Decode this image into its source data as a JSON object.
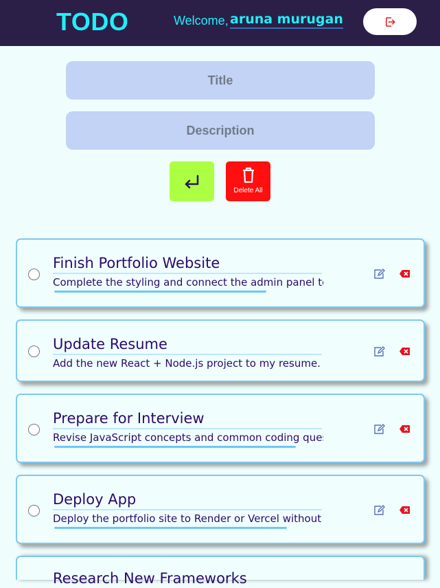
{
  "header": {
    "logo": "TODO",
    "welcome_text": "Welcome,",
    "user_name": "aruna murugan",
    "logout_icon": "logout-icon"
  },
  "form": {
    "title_placeholder": "Title",
    "description_placeholder": "Description",
    "enter_icon": "enter-icon",
    "delete_all_label": "Delete All",
    "delete_all_icon": "trash-icon"
  },
  "todos": [
    {
      "title": "Finish Portfolio Website",
      "description": "Complete the styling and connect the admin panel to",
      "completed": false
    },
    {
      "title": "Update Resume",
      "description": "Add the new React + Node.js project to my resume.",
      "completed": false
    },
    {
      "title": "Prepare for Interview",
      "description": "Revise JavaScript concepts and common coding ques",
      "completed": false
    },
    {
      "title": "Deploy App",
      "description": "Deploy the portfolio site to Render or Vercel without",
      "completed": false
    },
    {
      "title": "Research New Frameworks",
      "description": "",
      "completed": false
    }
  ],
  "colors": {
    "header_bg": "#2b1f48",
    "accent_cyan": "#1ff0f8",
    "page_bg": "#effefd",
    "input_bg": "#c3d3f5",
    "enter_btn": "#adff44",
    "delete_btn": "#ff0f0f",
    "todo_text": "#2a0a6b",
    "card_border": "#7fc8f0"
  }
}
